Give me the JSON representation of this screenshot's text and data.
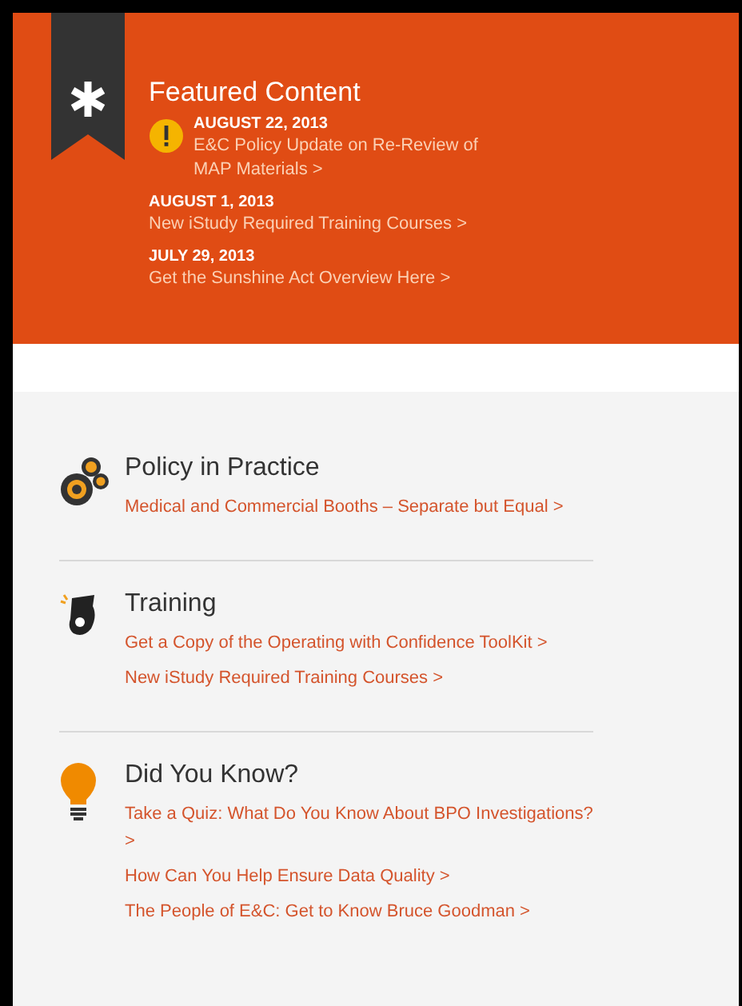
{
  "featured": {
    "title": "Featured Content",
    "items": [
      {
        "date": "AUGUST 22, 2013",
        "link": "E&C Policy Update on Re-Review of MAP Materials >",
        "alert": true
      },
      {
        "date": "AUGUST 1, 2013",
        "link": "New iStudy Required Training Courses >",
        "alert": false
      },
      {
        "date": "JULY 29, 2013",
        "link": "Get the Sunshine Act Overview Here >",
        "alert": false
      }
    ]
  },
  "sections": [
    {
      "kind": "gears",
      "title": "Policy in Practice",
      "links": [
        "Medical and Commercial Booths – Separate but Equal >"
      ]
    },
    {
      "kind": "whistle",
      "title": "Training",
      "links": [
        "Get a Copy of the Operating with Confidence ToolKit >",
        "New iStudy Required Training Courses >"
      ]
    },
    {
      "kind": "bulb",
      "title": "Did You Know?",
      "links": [
        "Take a Quiz: What Do You Know About BPO Investigations? >",
        "How Can You Help Ensure Data Quality >",
        "The People of E&C: Get to Know Bruce Goodman >"
      ]
    }
  ]
}
